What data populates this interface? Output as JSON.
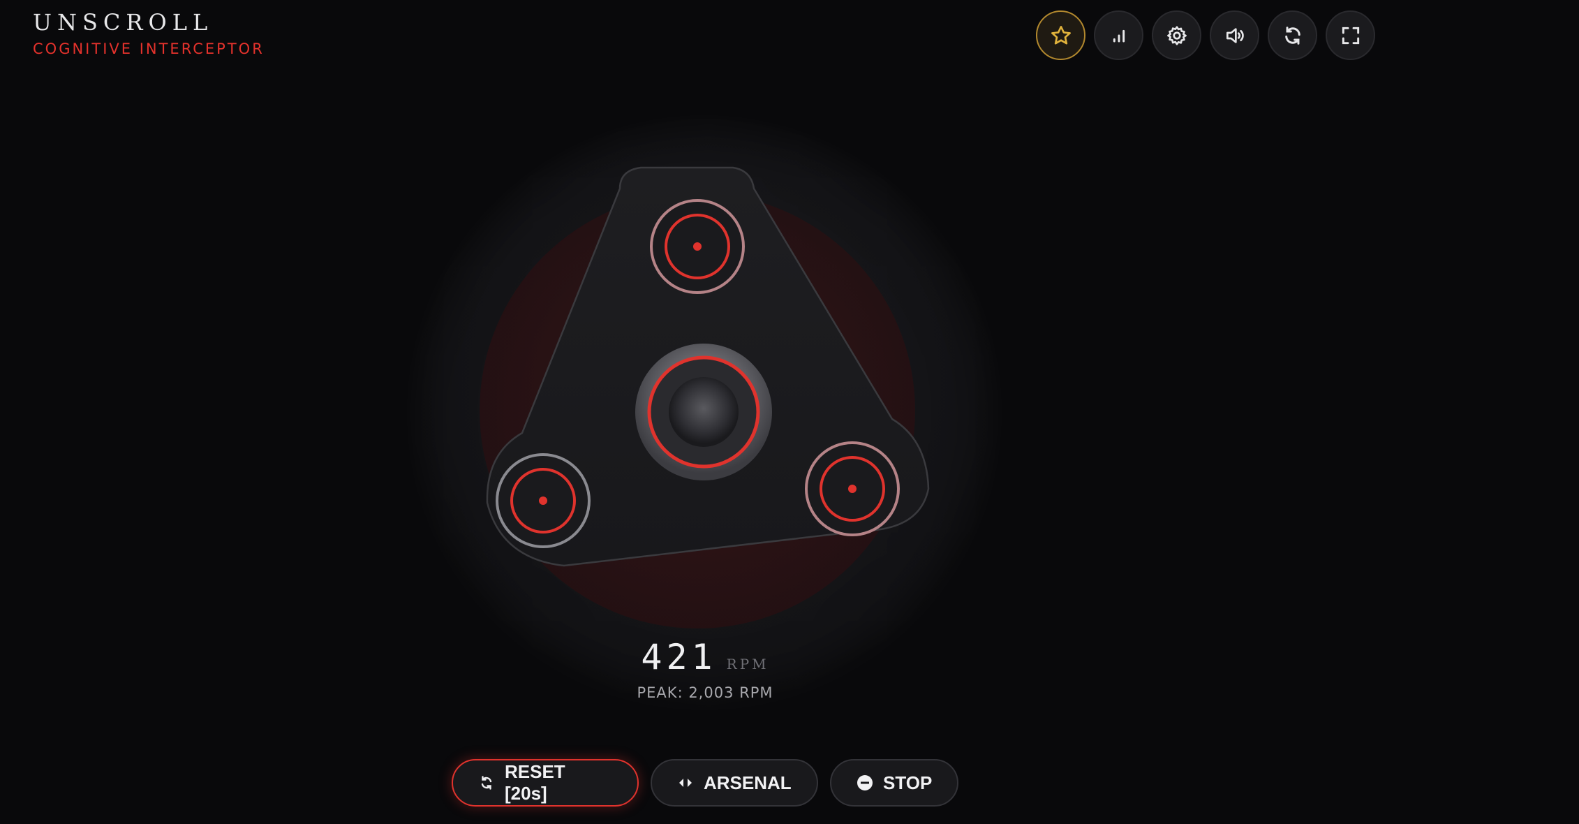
{
  "brand": {
    "title": "UNSCROLL",
    "subtitle": "COGNITIVE INTERCEPTOR"
  },
  "toolbar": {
    "items": [
      {
        "icon": "star-icon",
        "active": true
      },
      {
        "icon": "bar-chart-icon",
        "active": false
      },
      {
        "icon": "gear-icon",
        "active": false
      },
      {
        "icon": "volume-icon",
        "active": false
      },
      {
        "icon": "refresh-icon",
        "active": false
      },
      {
        "icon": "fullscreen-icon",
        "active": false
      }
    ]
  },
  "spinner": {
    "rpm": "421",
    "rpm_unit": "RPM",
    "peak_label": "PEAK: 2,003 RPM"
  },
  "controls": {
    "reset_label": "RESET [20s]",
    "arsenal_label": "ARSENAL",
    "stop_label": "STOP"
  },
  "colors": {
    "accent": "#e5322c",
    "star": "#e0b23c",
    "background": "#09090b"
  }
}
